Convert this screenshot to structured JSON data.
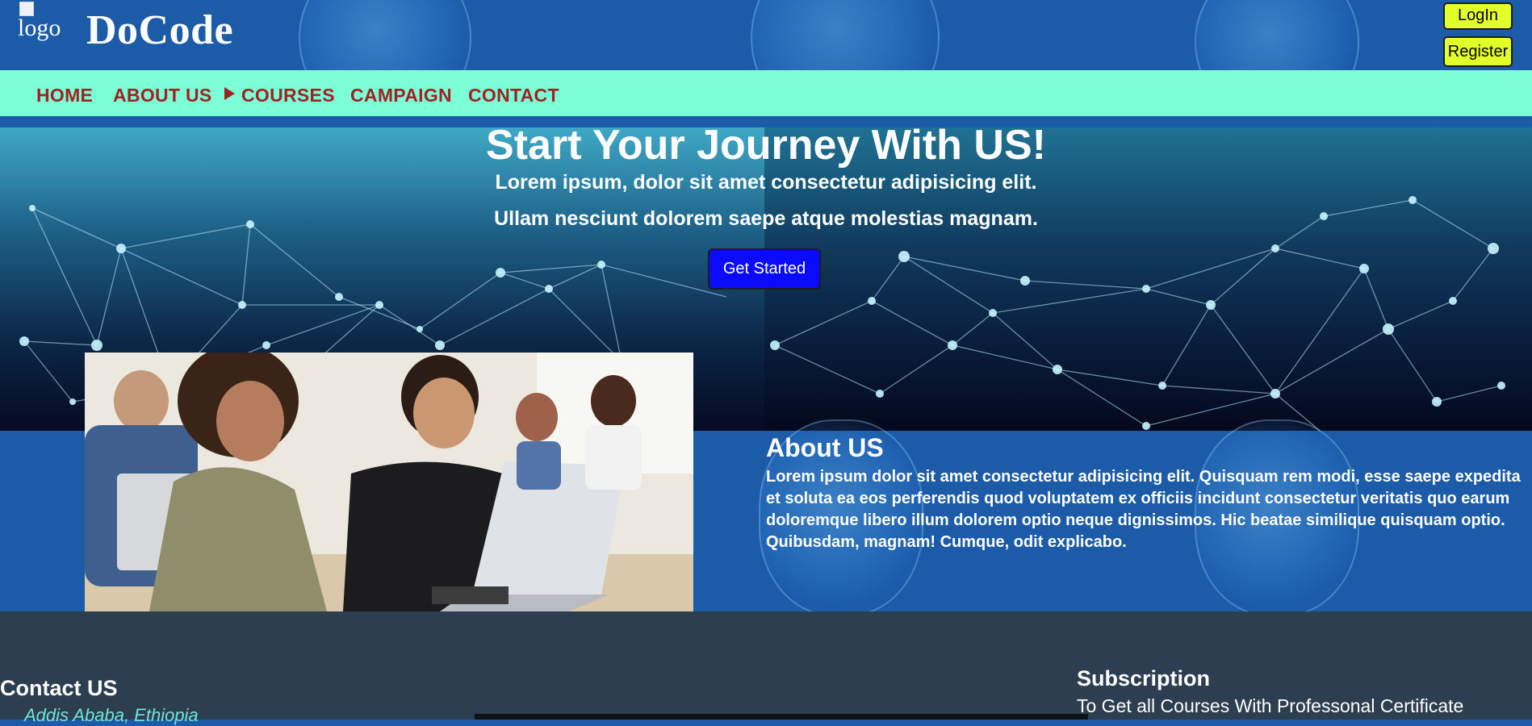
{
  "header": {
    "logo_alt": "logo",
    "brand": "DoCode",
    "login_label": "LogIn",
    "register_label": "Register"
  },
  "nav": {
    "items": [
      {
        "label": "HOME"
      },
      {
        "label": "ABOUT US"
      },
      {
        "label": "COURSES",
        "icon": "triangle-right-icon"
      },
      {
        "label": "CAMPAIGN"
      },
      {
        "label": "CONTACT"
      }
    ]
  },
  "hero": {
    "title": "Start Your Journey With US!",
    "subtitle_1": "Lorem ipsum, dolor sit amet consectetur adipisicing elit.",
    "subtitle_2": "Ullam nesciunt dolorem saepe atque molestias magnam.",
    "cta_label": "Get Started"
  },
  "about": {
    "title": "About US",
    "body": "Lorem ipsum dolor sit amet consectetur adipisicing elit. Quisquam rem modi, esse saepe expedita et soluta ea eos perferendis quod voluptatem ex officiis incidunt consectetur veritatis quo earum doloremque libero illum dolorem optio neque dignissimos. Hic beatae similique quisquam optio. Quibusdam, magnam! Cumque, odit explicabo."
  },
  "footer": {
    "contact_title": "Contact US",
    "address": "Addis Ababa, Ethiopia",
    "subscription_title": "Subscription",
    "subscription_text": "To Get all Courses With Professonal Certificate"
  },
  "colors": {
    "page_bg": "#1b5ba8",
    "nav_bg": "#7cffd6",
    "nav_text": "#9e2323",
    "auth_button": "#e3ff2a",
    "cta_button": "#0a0aff",
    "footer_bg": "#2c3e50",
    "address_text": "#6fe6d8"
  }
}
